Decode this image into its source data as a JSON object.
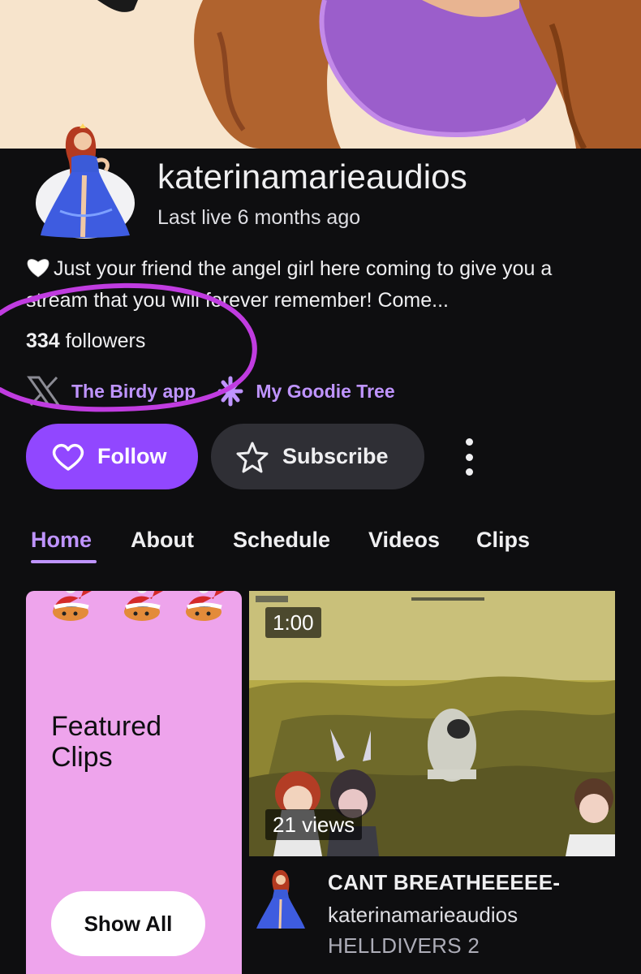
{
  "channel": {
    "name": "katerinamarieaudios",
    "last_live": "Last live 6 months ago",
    "bio": "Just your friend the angel girl here coming to give you a stream that you will forever remember! Come...",
    "followers_count": "334",
    "followers_label": "followers"
  },
  "links": [
    {
      "label": "The Birdy app",
      "icon": "x-logo-icon"
    },
    {
      "label": "My Goodie Tree",
      "icon": "linktree-icon"
    }
  ],
  "actions": {
    "follow_label": "Follow",
    "subscribe_label": "Subscribe"
  },
  "tabs": [
    "Home",
    "About",
    "Schedule",
    "Videos",
    "Clips"
  ],
  "active_tab": "Home",
  "featured": {
    "title": "Featured Clips",
    "show_all_label": "Show All"
  },
  "clip": {
    "duration": "1:00",
    "views": "21 views",
    "title": "CANT BREATHEEEEE-",
    "author": "katerinamarieaudios",
    "game": "HELLDIVERS 2"
  },
  "colors": {
    "accent": "#9147ff",
    "link": "#bf94ff",
    "background": "#0e0e10",
    "featured_bg": "#eea4ec",
    "annotation": "#c03ce0"
  }
}
